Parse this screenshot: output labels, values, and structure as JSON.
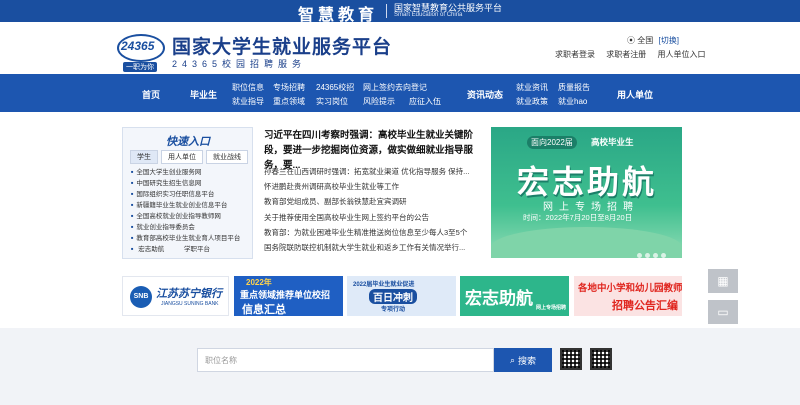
{
  "topstrip": {
    "brand_cn": "智慧教育",
    "line1": "国家智慧教育公共服务平台",
    "line2": "Smart Education of China"
  },
  "header": {
    "logo_num": "24365",
    "logo_tag": "一职为你",
    "title": "国家大学生就业服务平台",
    "subtitle": "24365校园招聘服务",
    "region": "全国",
    "region_switch": "[切换]",
    "links": [
      "求职者登录",
      "求职者注册",
      "用人单位入口"
    ]
  },
  "nav": {
    "home": "首页",
    "graduate": "毕业生",
    "g_items": [
      "职位信息",
      "专场招聘",
      "24365校招",
      "网上签约去向登记",
      "就业指导",
      "重点领域",
      "实习岗位",
      "风险提示",
      "应征入伍"
    ],
    "news": "资讯动态",
    "n_items": [
      "就业资讯",
      "质量报告",
      "就业政策",
      "就业hao"
    ],
    "employer": "用人单位"
  },
  "quick": {
    "title": "快速入口",
    "tabs": [
      "学生",
      "用人单位",
      "就业战线"
    ],
    "items": [
      "全国大学生创业服务网",
      "中国研究生招生信息网",
      "国际组织实习任职信息平台",
      "新疆籍毕业生就业创业信息平台",
      "全国高校就业创业指导教师网",
      "就业创业指导委员会",
      "教育部高校毕业生就业育人项目平台",
      "宏志助航",
      "学职平台"
    ]
  },
  "main": {
    "headline": "习近平在四川考察时强调：高校毕业生就业关键阶段，要进一步挖掘岗位资源，做实做细就业指导服务，要...",
    "news": [
      "孙春兰在山西调研时强调：拓宽就业渠道 优化指导服务 保持...",
      "怀进鹏赴贵州调研高校毕业生就业等工作",
      "教育部党组成员、副部长翁铁慧赴宜宾调研",
      "关于推荐使用全国高校毕业生网上签约平台的公告",
      "教育部：为就业困难毕业生精准推送岗位信息至少每人3至5个",
      "国务院联防联控机制就大学生就业和返乡工作有关情况举行..."
    ]
  },
  "banner": {
    "pill": "面向2022届",
    "title": "高校毕业生",
    "big": "宏志助航",
    "sub": "网上专场招聘",
    "date": "时间：2022年7月20日至8月20日"
  },
  "bank": {
    "badge": "SNB",
    "name": "江苏苏宁银行",
    "en": "JIANGSU SUNING BANK"
  },
  "promos": [
    {
      "l1": "2022年",
      "l2": "重点领域推荐单位校招",
      "l3": "信息汇总"
    },
    {
      "l1": "2022届毕业生就业促进",
      "l2": "百日冲刺",
      "l3": "专项行动"
    },
    {
      "l1": "宏志助航",
      "l2": "网上专场招聘"
    },
    {
      "l1": "各地中小学和幼儿园教师",
      "l2": "招聘公告汇编"
    }
  ],
  "search": {
    "placeholder": "职位名称",
    "button": "搜索"
  },
  "colors": {
    "primary": "#1d56b0",
    "banner_green": "#2aa786"
  }
}
